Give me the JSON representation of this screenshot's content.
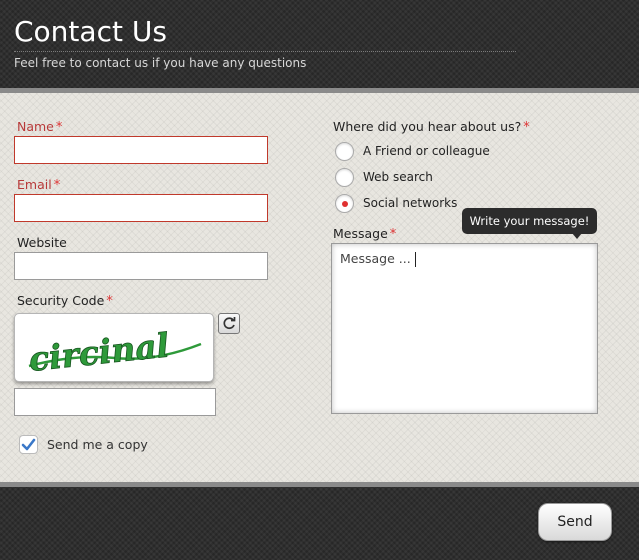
{
  "header": {
    "title": "Contact Us",
    "subtitle": "Feel free to contact us if you have any questions"
  },
  "form": {
    "name": {
      "label": "Name",
      "required_mark": "*",
      "value": "",
      "state": "error"
    },
    "email": {
      "label": "Email",
      "required_mark": "*",
      "value": "",
      "state": "error"
    },
    "website": {
      "label": "Website",
      "value": ""
    },
    "security_code": {
      "label": "Security Code",
      "required_mark": "*",
      "captcha_text": "circinal",
      "value": "",
      "refresh_icon": "refresh-icon"
    },
    "send_copy": {
      "label": "Send me a copy",
      "checked": true,
      "check_icon": "checkmark-icon"
    },
    "heard_about": {
      "label": "Where did you hear about us?",
      "required_mark": "*",
      "options": [
        {
          "label": "A Friend or colleague",
          "selected": false
        },
        {
          "label": "Web search",
          "selected": false
        },
        {
          "label": "Social networks",
          "selected": true
        }
      ]
    },
    "message": {
      "label": "Message",
      "required_mark": "*",
      "value": "Message ...",
      "tooltip": "Write your message!"
    }
  },
  "footer": {
    "send_label": "Send"
  },
  "colors": {
    "header_bg": "#2f2f2f",
    "error": "#c0392b",
    "required": "#dd3333",
    "radio_selected": "#e03131",
    "captcha_text": "#2e9a3a",
    "checkbox_check": "#3a78c8"
  }
}
